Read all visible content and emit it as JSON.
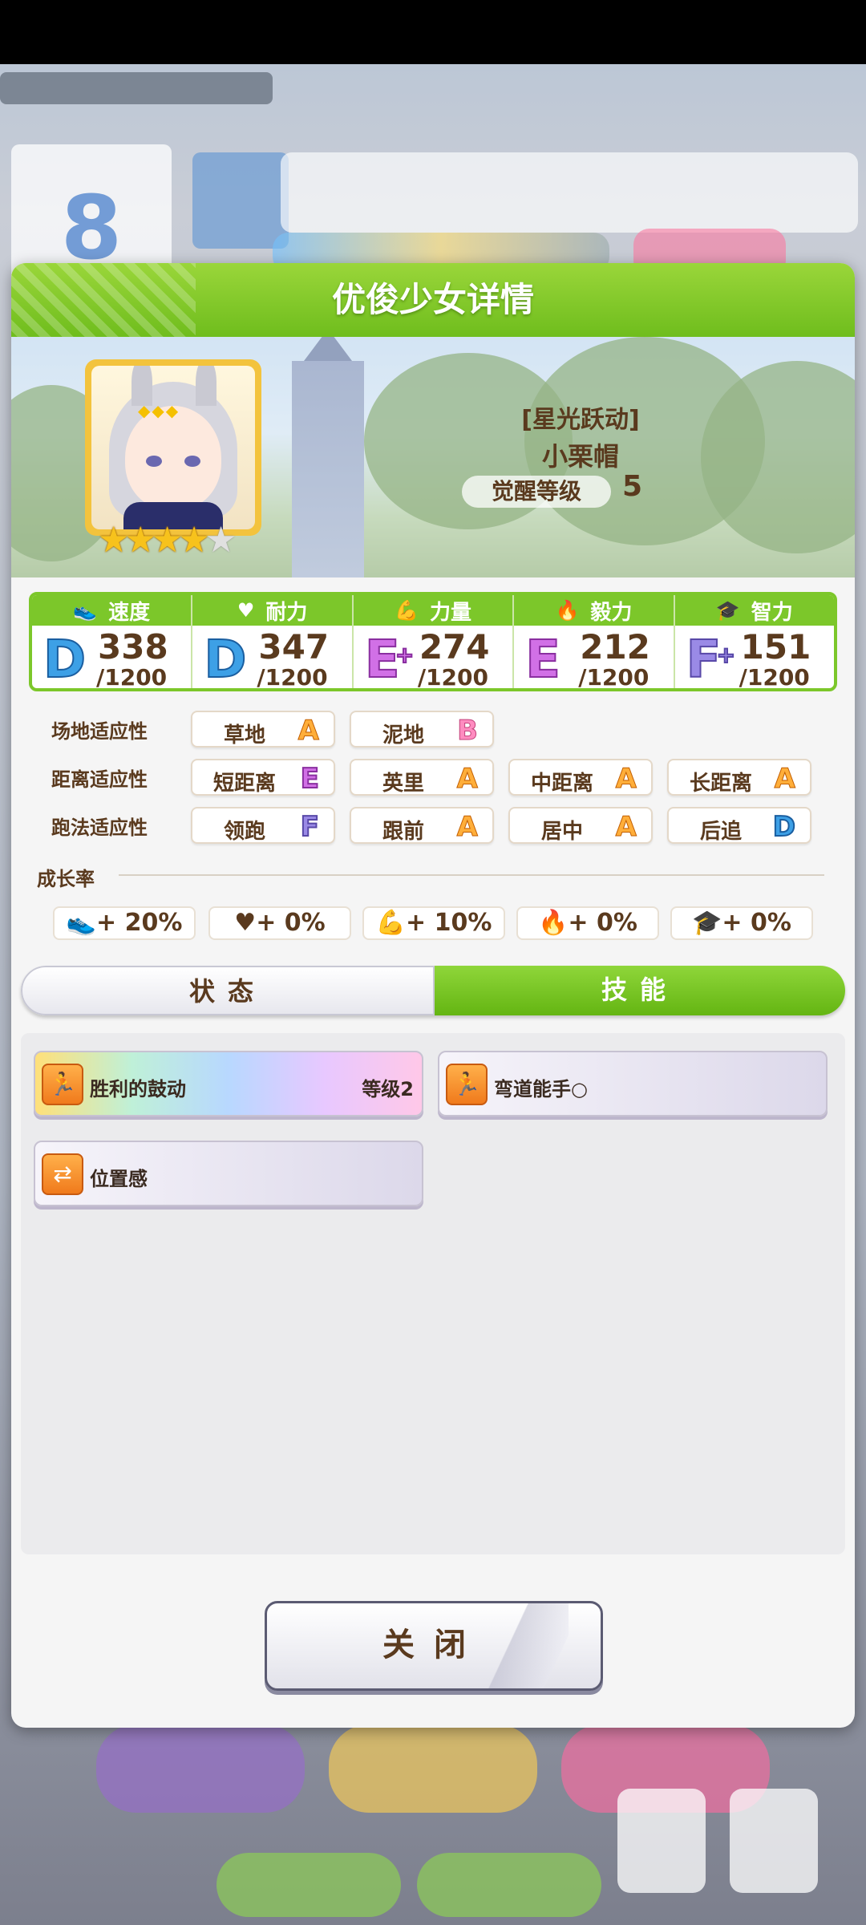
{
  "dialog": {
    "title": "优俊少女详情",
    "character": {
      "title": "[星光跃动]",
      "name": "小栗帽",
      "awaken_label": "觉醒等级",
      "awaken_level": "5",
      "stars_filled": 4,
      "stars_total": 5
    },
    "stats": [
      {
        "label": "速度",
        "icon": "shoe-icon",
        "grade": "D",
        "grade_plus": "",
        "value": "338",
        "max": "/1200",
        "color": "#3da0e6"
      },
      {
        "label": "耐力",
        "icon": "heart-icon",
        "grade": "D",
        "grade_plus": "",
        "value": "347",
        "max": "/1200",
        "color": "#3da0e6"
      },
      {
        "label": "力量",
        "icon": "muscle-icon",
        "grade": "E",
        "grade_plus": "+",
        "value": "274",
        "max": "/1200",
        "color": "#d170e6"
      },
      {
        "label": "毅力",
        "icon": "flame-icon",
        "grade": "E",
        "grade_plus": "",
        "value": "212",
        "max": "/1200",
        "color": "#d170e6"
      },
      {
        "label": "智力",
        "icon": "graduation-cap-icon",
        "grade": "F",
        "grade_plus": "+",
        "value": "151",
        "max": "/1200",
        "color": "#9a8ae6"
      }
    ],
    "aptitude": {
      "track": {
        "label": "场地适应性",
        "items": [
          {
            "name": "草地",
            "grade": "A"
          },
          {
            "name": "泥地",
            "grade": "B"
          }
        ]
      },
      "distance": {
        "label": "距离适应性",
        "items": [
          {
            "name": "短距离",
            "grade": "E"
          },
          {
            "name": "英里",
            "grade": "A"
          },
          {
            "name": "中距离",
            "grade": "A"
          },
          {
            "name": "长距离",
            "grade": "A"
          }
        ]
      },
      "style": {
        "label": "跑法适应性",
        "items": [
          {
            "name": "领跑",
            "grade": "F"
          },
          {
            "name": "跟前",
            "grade": "A"
          },
          {
            "name": "居中",
            "grade": "A"
          },
          {
            "name": "后追",
            "grade": "D"
          }
        ]
      }
    },
    "growth": {
      "label": "成长率",
      "items": [
        {
          "icon": "shoe-icon",
          "value": "+ 20%"
        },
        {
          "icon": "heart-icon",
          "value": "+ 0%"
        },
        {
          "icon": "muscle-icon",
          "value": "+ 10%"
        },
        {
          "icon": "flame-icon",
          "value": "+ 0%"
        },
        {
          "icon": "graduation-cap-icon",
          "value": "+ 0%"
        }
      ]
    },
    "tabs": [
      {
        "label": "状态",
        "active": false
      },
      {
        "label": "技能",
        "active": true
      }
    ],
    "skills": [
      {
        "name": "胜利的鼓动",
        "level": "等级2",
        "style": "rainbow",
        "icon": "running-figure-icon"
      },
      {
        "name": "弯道能手○",
        "level": "",
        "style": "plain",
        "icon": "running-figure-icon"
      },
      {
        "name": "位置感",
        "level": "",
        "style": "plain",
        "icon": "position-arrows-icon"
      }
    ],
    "close_label": "关闭"
  }
}
